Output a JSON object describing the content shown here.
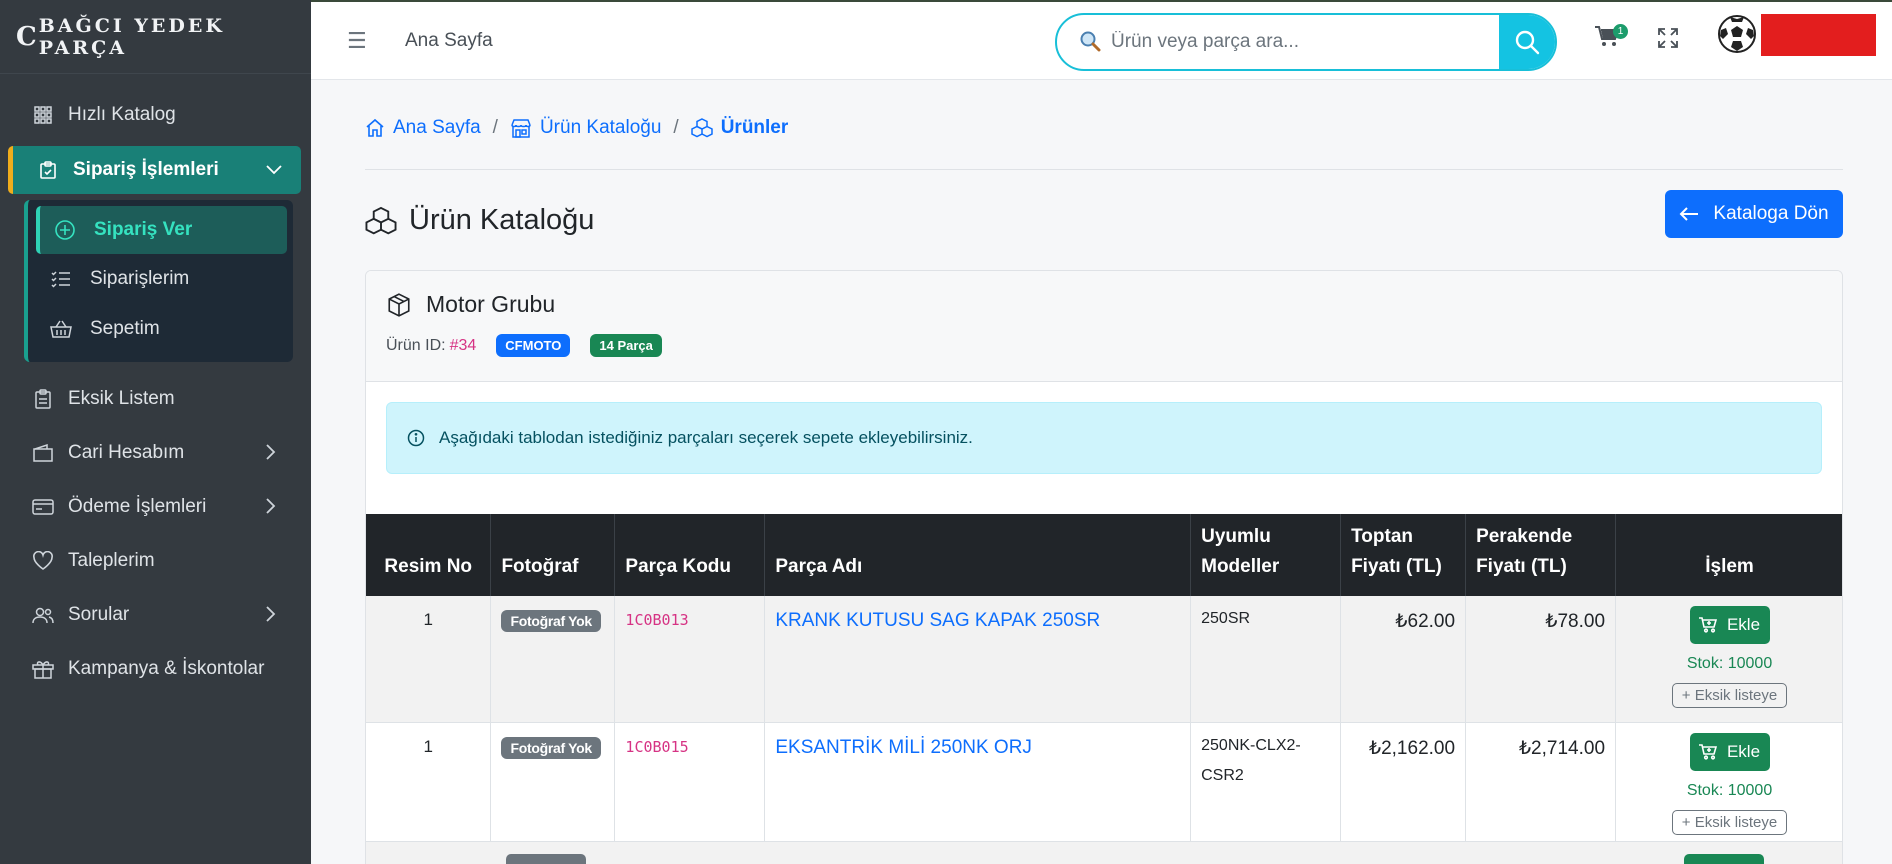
{
  "brand": {
    "mark": "C",
    "name": "BAĞCI YEDEK PARÇA"
  },
  "sidebar": {
    "items": [
      {
        "label": "Hızlı Katalog",
        "icon": "grid-icon"
      },
      {
        "label": "Sipariş İşlemleri",
        "icon": "clipboard-check-icon",
        "active": true
      },
      {
        "label": "Eksik Listem",
        "icon": "clipboard-icon"
      },
      {
        "label": "Cari Hesabım",
        "icon": "wallet-icon"
      },
      {
        "label": "Ödeme İşlemleri",
        "icon": "credit-card-icon"
      },
      {
        "label": "Taleplerim",
        "icon": "heart-icon"
      },
      {
        "label": "Sorular",
        "icon": "people-icon"
      },
      {
        "label": "Kampanya & İskontolar",
        "icon": "gift-icon"
      }
    ],
    "submenu": [
      {
        "label": "Sipariş Ver",
        "icon": "plus-circle-icon",
        "active": true
      },
      {
        "label": "Siparişlerim",
        "icon": "list-check-icon"
      },
      {
        "label": "Sepetim",
        "icon": "basket-icon"
      }
    ]
  },
  "header": {
    "title": "Ana Sayfa",
    "search_placeholder": "Ürün veya parça ara...",
    "cart_count": "1",
    "accent": "#14c3e2"
  },
  "breadcrumb": [
    {
      "label": "Ana Sayfa",
      "icon": "house-icon"
    },
    {
      "label": "Ürün Kataloğu",
      "icon": "shop-icon"
    },
    {
      "label": "Ürünler",
      "icon": "boxes-icon"
    }
  ],
  "page": {
    "title": "Ürün Kataloğu",
    "back_label": "Kataloga Dön"
  },
  "card": {
    "title": "Motor Grubu",
    "id_label": "Ürün ID:",
    "id_value": "#34",
    "brand_badge": "CFMOTO",
    "count_badge": "14 Parça",
    "alert": "Aşağıdaki tablodan istediğiniz parçaları seçerek sepete ekleyebilirsiniz."
  },
  "table": {
    "headers": [
      "Resim No",
      "Fotoğraf",
      "Parça Kodu",
      "Parça Adı",
      "Uyumlu Modeller",
      "Toptan Fiyatı (TL)",
      "Perakende Fiyatı (TL)",
      "İşlem"
    ],
    "header_lines": {
      "models": [
        "Uyumlu",
        "Modeller"
      ],
      "wholesale": [
        "Toptan",
        "Fiyatı (TL)"
      ],
      "retail": [
        "Perakende",
        "Fiyatı (TL)"
      ]
    },
    "add_label": "Ekle",
    "missing_label": "+ Eksik listeye",
    "rows": [
      {
        "no": "1",
        "photo": "Fotoğraf Yok",
        "code": "1C0B013",
        "name": "KRANK KUTUSU SAG KAPAK 250SR",
        "models": [
          "250SR"
        ],
        "wholesale": "₺62.00",
        "retail": "₺78.00",
        "stock": "Stok: 10000"
      },
      {
        "no": "1",
        "photo": "Fotoğraf Yok",
        "code": "1C0B015",
        "name": "EKSANTRİK MİLİ 250NK ORJ",
        "models": [
          "250NK-CLX2-",
          "CSR2"
        ],
        "wholesale": "₺2,162.00",
        "retail": "₺2,714.00",
        "stock": "Stok: 10000"
      }
    ]
  }
}
